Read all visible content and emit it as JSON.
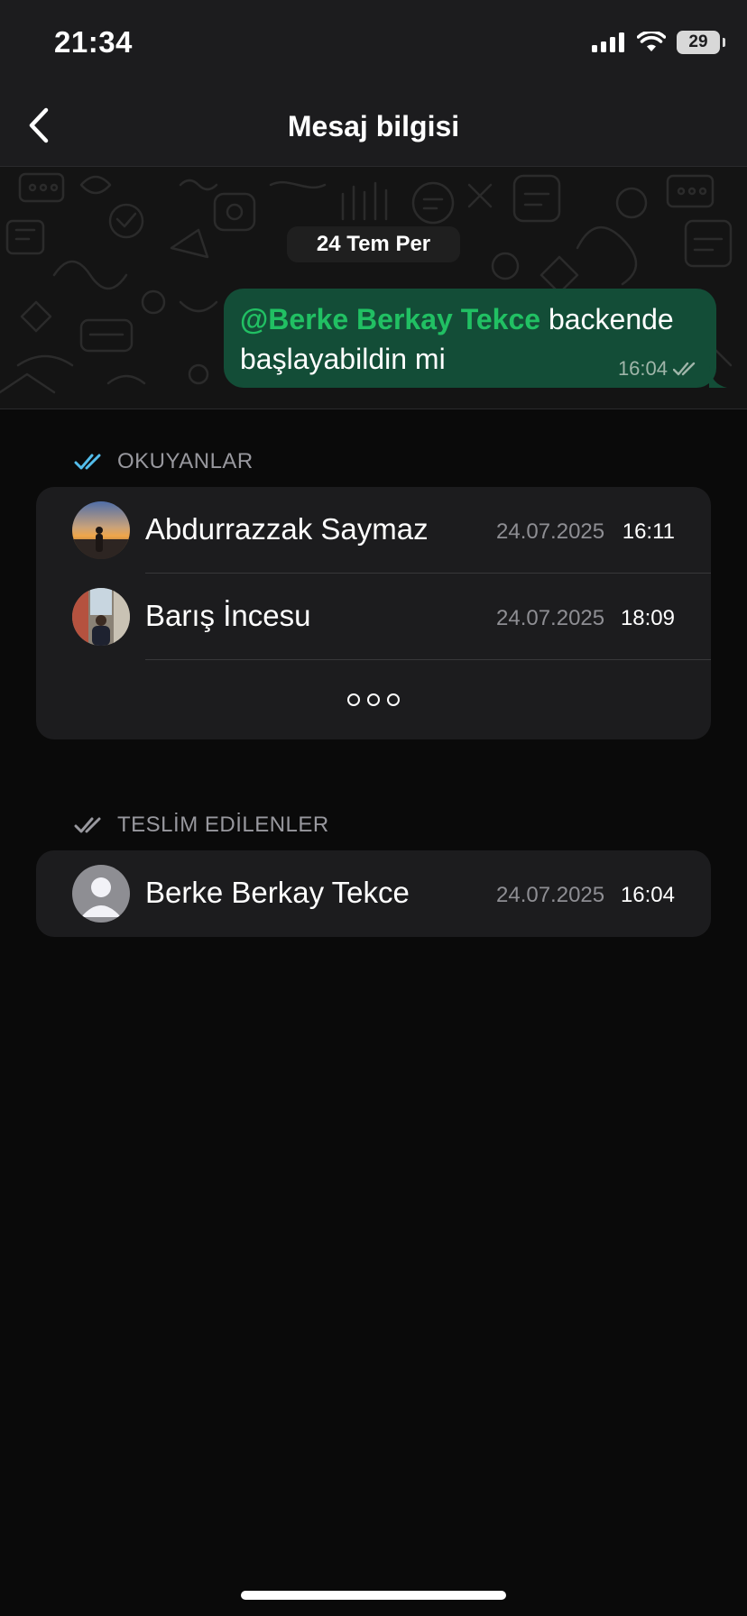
{
  "status_bar": {
    "time": "21:34",
    "battery": "29",
    "icons": [
      "signal-icon",
      "wifi-icon",
      "battery-icon"
    ]
  },
  "header": {
    "title": "Mesaj bilgisi",
    "back_icon": "chevron-left-icon"
  },
  "chat": {
    "date": "24 Tem Per",
    "message": {
      "mention": "@Berke Berkay Tekce",
      "text": " backende başlayabildin mi",
      "time": "16:04",
      "status_icon": "double-check-icon"
    }
  },
  "read_section": {
    "title": "OKUYANLAR",
    "icon": "double-check-blue-icon",
    "contacts": [
      {
        "name": "Abdurrazzak Saymaz",
        "date": "24.07.2025",
        "time": "16:11",
        "avatar": "sunset-photo"
      },
      {
        "name": "Barış İncesu",
        "date": "24.07.2025",
        "time": "18:09",
        "avatar": "street-photo"
      }
    ],
    "more_icon": "more-dots-icon"
  },
  "delivered_section": {
    "title": "TESLİM EDİLENLER",
    "icon": "double-check-gray-icon",
    "contacts": [
      {
        "name": "Berke Berkay Tekce",
        "date": "24.07.2025",
        "time": "16:04",
        "avatar": "default-person"
      }
    ]
  },
  "colors": {
    "background": "#0a0a0a",
    "bar": "#1c1c1e",
    "card": "#1c1c1e",
    "bubble": "#134d37",
    "mention": "#21c063",
    "read_tick": "#53bdeb",
    "secondary_text": "#8e8e93"
  }
}
